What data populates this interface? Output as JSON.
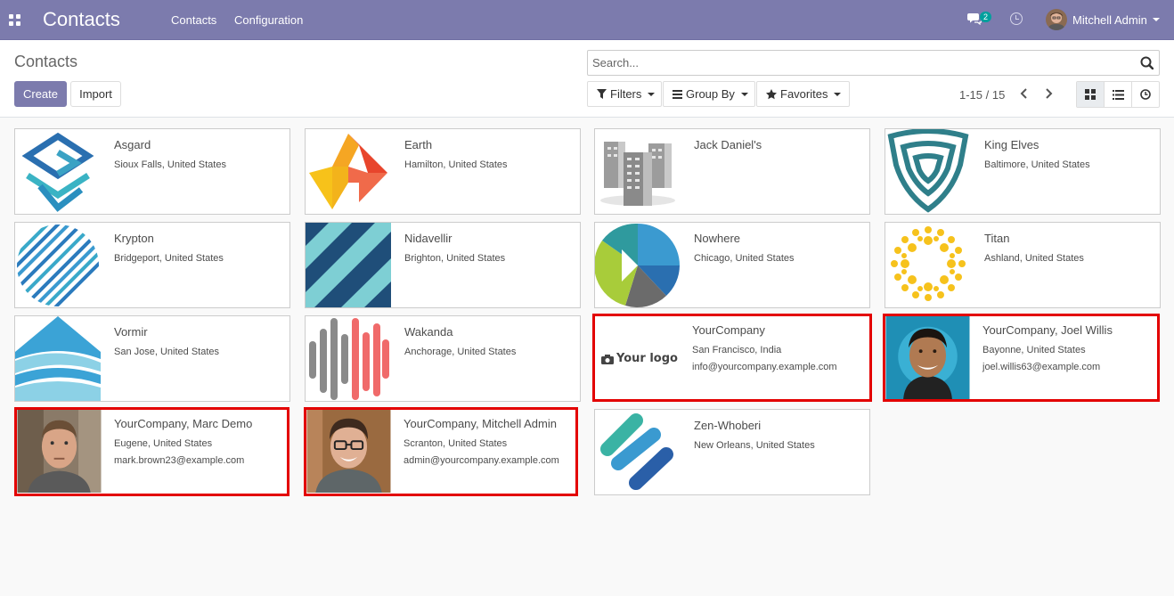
{
  "navbar": {
    "app_title": "Contacts",
    "menu": [
      "Contacts",
      "Configuration"
    ],
    "chat_badge": "2",
    "user_name": "Mitchell Admin",
    "bg_color": "#7c7bad"
  },
  "control": {
    "title": "Contacts",
    "create_label": "Create",
    "import_label": "Import",
    "search_placeholder": "Search...",
    "filters_label": "Filters",
    "groupby_label": "Group By",
    "favorites_label": "Favorites",
    "pager": "1-15 / 15",
    "views": [
      "kanban-icon",
      "list-icon",
      "activity-icon"
    ],
    "active_view": "kanban"
  },
  "cards": [
    {
      "name": "Asgard",
      "location": "Sioux Falls, United States",
      "email": "",
      "image": "asgard-logo",
      "highlighted": false
    },
    {
      "name": "Earth",
      "location": "Hamilton, United States",
      "email": "",
      "image": "earth-logo",
      "highlighted": false
    },
    {
      "name": "Jack Daniel's",
      "location": "",
      "email": "",
      "image": "buildings-placeholder",
      "highlighted": false
    },
    {
      "name": "King Elves",
      "location": "Baltimore, United States",
      "email": "",
      "image": "king-elves-logo",
      "highlighted": false
    },
    {
      "name": "Krypton",
      "location": "Bridgeport, United States",
      "email": "",
      "image": "krypton-logo",
      "highlighted": false
    },
    {
      "name": "Nidavellir",
      "location": "Brighton, United States",
      "email": "",
      "image": "nidavellir-logo",
      "highlighted": false
    },
    {
      "name": "Nowhere",
      "location": "Chicago, United States",
      "email": "",
      "image": "nowhere-logo",
      "highlighted": false
    },
    {
      "name": "Titan",
      "location": "Ashland, United States",
      "email": "",
      "image": "titan-logo",
      "highlighted": false
    },
    {
      "name": "Vormir",
      "location": "San Jose, United States",
      "email": "",
      "image": "vormir-logo",
      "highlighted": false
    },
    {
      "name": "Wakanda",
      "location": "Anchorage, United States",
      "email": "",
      "image": "wakanda-logo",
      "highlighted": false
    },
    {
      "name": "YourCompany",
      "location": "San Francisco, India",
      "email": "info@yourcompany.example.com",
      "image": "your-logo",
      "logo_text": "Your logo",
      "highlighted": true
    },
    {
      "name": "YourCompany, Joel Willis",
      "location": "Bayonne, United States",
      "email": "joel.willis63@example.com",
      "image": "photo-joel",
      "highlighted": true
    },
    {
      "name": "YourCompany, Marc Demo",
      "location": "Eugene, United States",
      "email": "mark.brown23@example.com",
      "image": "photo-marc",
      "highlighted": true
    },
    {
      "name": "YourCompany, Mitchell Admin",
      "location": "Scranton, United States",
      "email": "admin@yourcompany.example.com",
      "image": "photo-mitchell",
      "highlighted": true
    },
    {
      "name": "Zen-Whoberi",
      "location": "New Orleans, United States",
      "email": "",
      "image": "zen-whoberi-logo",
      "highlighted": false
    }
  ]
}
